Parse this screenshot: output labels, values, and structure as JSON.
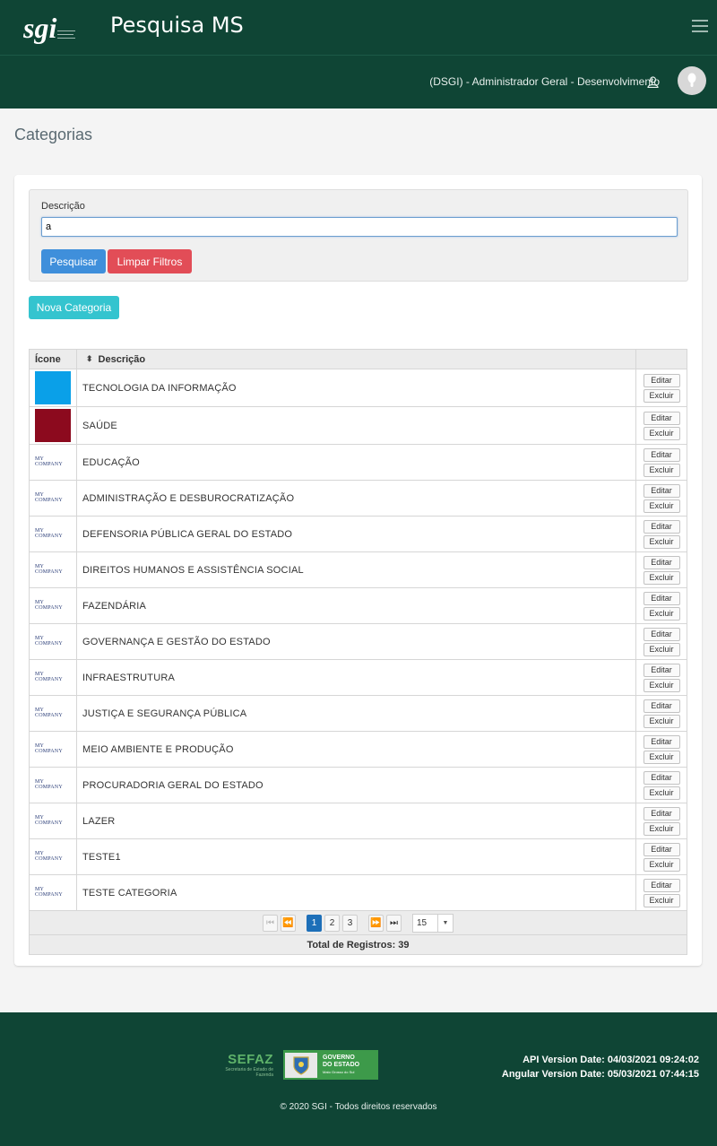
{
  "header": {
    "logo_text": "sgi",
    "app_title": "Pesquisa MS",
    "user_label": "(DSGI) - Administrador Geral - Desenvolvimento"
  },
  "page": {
    "title": "Categorias"
  },
  "filters": {
    "description_label": "Descrição",
    "description_value": "a",
    "search_label": "Pesquisar",
    "clear_label": "Limpar Filtros"
  },
  "actions": {
    "new_category_label": "Nova Categoria"
  },
  "table": {
    "columns": {
      "icon": "Ícone",
      "description": "Descrição"
    },
    "edit_label": "Editar",
    "delete_label": "Excluir",
    "rows": [
      {
        "icon": "swatch",
        "color": "#0aa0e8",
        "description": "TECNOLOGIA DA INFORMAÇÃO"
      },
      {
        "icon": "swatch",
        "color": "#8c0a1e",
        "description": "SAÚDE"
      },
      {
        "icon": "my-company-logo",
        "description": "EDUCAÇÃO"
      },
      {
        "icon": "my-company-logo",
        "description": "ADMINISTRAÇÃO E DESBUROCRATIZAÇÃO"
      },
      {
        "icon": "my-company-logo",
        "description": "DEFENSORIA PÚBLICA GERAL DO ESTADO"
      },
      {
        "icon": "my-company-logo",
        "description": "DIREITOS HUMANOS E ASSISTÊNCIA SOCIAL"
      },
      {
        "icon": "my-company-logo",
        "description": "FAZENDÁRIA"
      },
      {
        "icon": "my-company-logo",
        "description": "GOVERNANÇA E GESTÃO DO ESTADO"
      },
      {
        "icon": "my-company-logo",
        "description": "INFRAESTRUTURA"
      },
      {
        "icon": "my-company-logo",
        "description": "JUSTIÇA E SEGURANÇA PÚBLICA"
      },
      {
        "icon": "my-company-logo",
        "description": "MEIO AMBIENTE E PRODUÇÃO"
      },
      {
        "icon": "my-company-logo",
        "description": "PROCURADORIA GERAL DO ESTADO"
      },
      {
        "icon": "my-company-logo",
        "description": "LAZER"
      },
      {
        "icon": "my-company-logo",
        "description": "TESTE1"
      },
      {
        "icon": "my-company-logo",
        "description": "TESTE CATEGORIA"
      }
    ],
    "my_company_logo_text": "MY COMPANY",
    "pagination": {
      "pages": [
        "1",
        "2",
        "3"
      ],
      "current_page": "1",
      "page_size": "15",
      "total_text": "Total de Registros: 39"
    }
  },
  "footer": {
    "sefaz_title": "SEFAZ",
    "sefaz_subtitle": "Secretaria de Estado de Fazenda",
    "gov_line1": "GOVERNO",
    "gov_line2": "DO ESTADO",
    "gov_line3": "Mato Grosso do Sul",
    "api_version": "API Version Date: 04/03/2021 09:24:02",
    "angular_version": "Angular Version Date: 05/03/2021 07:44:15",
    "copyright": "© 2020 SGI - Todos direitos reservados"
  },
  "colors": {
    "header_bg": "#0f4535",
    "btn_search": "#3f8fdb",
    "btn_clear": "#e24d57",
    "btn_new": "#34c4cf",
    "pager_active": "#1d6fb8"
  }
}
